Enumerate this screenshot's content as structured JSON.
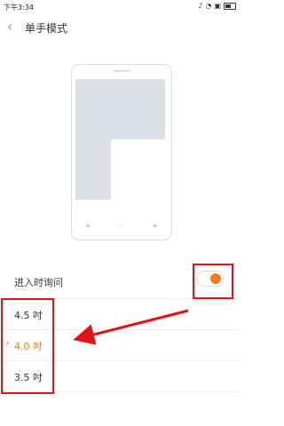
{
  "status": {
    "time": "下午3:34"
  },
  "header": {
    "back_icon": "chevron-left-icon",
    "title": "单手模式"
  },
  "preview": {
    "icon": "phone-illustration"
  },
  "settings": {
    "enter_prompt_label": "进入时询问",
    "enter_prompt_enabled": true
  },
  "sizes": {
    "options": [
      {
        "label": "4.5 吋",
        "selected": false
      },
      {
        "label": "4.0 吋",
        "selected": true
      },
      {
        "label": "3.5 吋",
        "selected": false
      }
    ]
  },
  "colors": {
    "accent": "#f07c22",
    "annotation": "#e0121a"
  }
}
